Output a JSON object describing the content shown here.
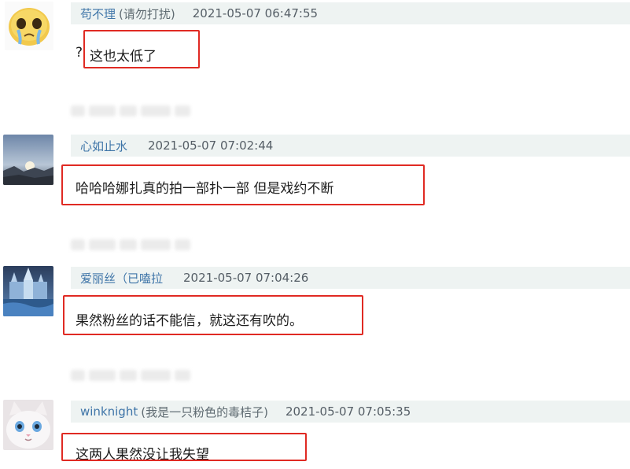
{
  "comments": [
    {
      "username": "苟不理",
      "note": "(请勿打扰)",
      "time": "2021-05-07 06:47:55",
      "prefix": "?",
      "text": "这也太低了",
      "avatar_icon": "crying-emoji-avatar-icon"
    },
    {
      "username": "心如止水",
      "note": "",
      "time": "2021-05-07 07:02:44",
      "prefix": "",
      "text": "哈哈哈娜扎真的拍一部扑一部 但是戏约不断",
      "avatar_icon": "landscape-sunset-avatar-icon"
    },
    {
      "username": "爱丽丝（已嗑拉",
      "note": "",
      "time": "2021-05-07 07:04:26",
      "prefix": "",
      "text": "果然粉丝的话不能信，就这还有吹的。",
      "avatar_icon": "ice-castle-avatar-icon"
    },
    {
      "username": "winknight",
      "note": "(我是一只粉色的毒桔子)",
      "time": "2021-05-07 07:05:35",
      "prefix": "",
      "text": "这两人果然没让我失望",
      "avatar_icon": "white-cat-avatar-icon"
    }
  ],
  "colors": {
    "username": "#3f75a8",
    "header_bg": "#eef3f2",
    "highlight_border": "#e02a23"
  }
}
